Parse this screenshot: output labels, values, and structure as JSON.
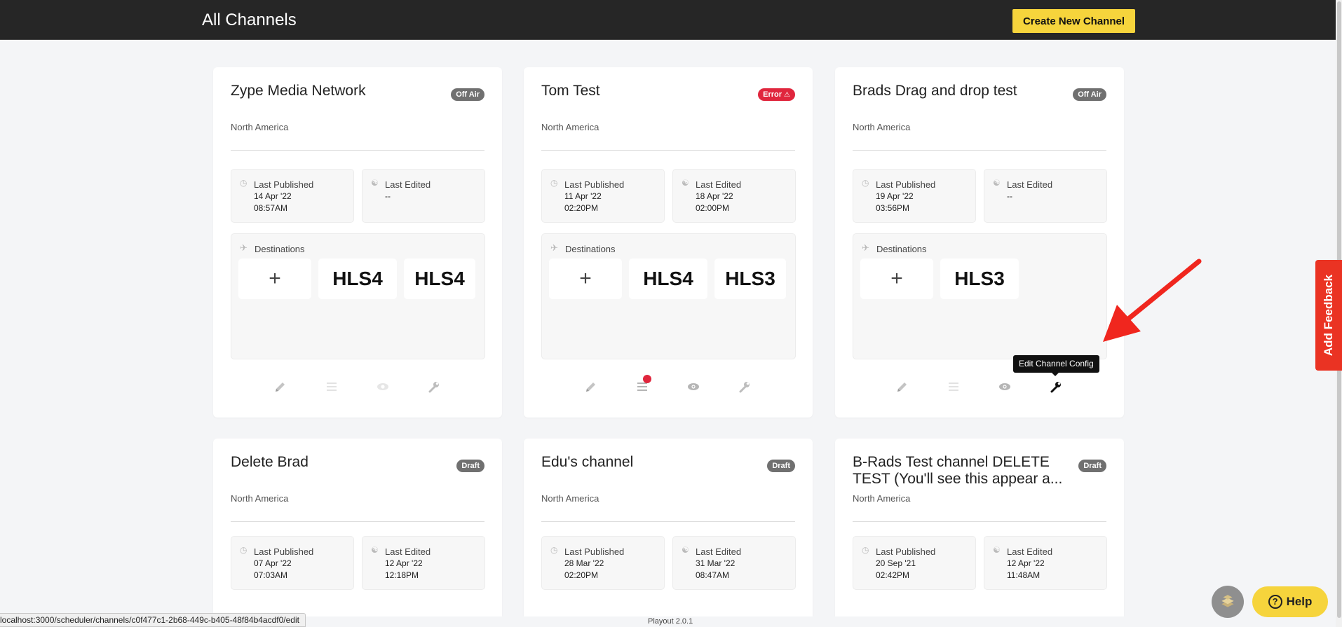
{
  "header": {
    "title": "All Channels",
    "create_button": "Create New Channel"
  },
  "channels": [
    {
      "name": "Zype Media Network",
      "status": "Off Air",
      "region": "North America",
      "last_published": {
        "label": "Last Published",
        "date": "14 Apr '22",
        "time": "08:57AM"
      },
      "last_edited": {
        "label": "Last Edited",
        "date": "--",
        "time": ""
      },
      "destinations_label": "Destinations",
      "destinations": [
        "+",
        "HLS4",
        "HLS4"
      ]
    },
    {
      "name": "Tom Test",
      "status": "Error",
      "region": "North America",
      "last_published": {
        "label": "Last Published",
        "date": "11 Apr '22",
        "time": "02:20PM"
      },
      "last_edited": {
        "label": "Last Edited",
        "date": "18 Apr '22",
        "time": "02:00PM"
      },
      "destinations_label": "Destinations",
      "destinations": [
        "+",
        "HLS4",
        "HLS3"
      ]
    },
    {
      "name": "Brads Drag and drop test",
      "status": "Off Air",
      "region": "North America",
      "last_published": {
        "label": "Last Published",
        "date": "19 Apr '22",
        "time": "03:56PM"
      },
      "last_edited": {
        "label": "Last Edited",
        "date": "--",
        "time": ""
      },
      "destinations_label": "Destinations",
      "destinations": [
        "+",
        "HLS3"
      ]
    },
    {
      "name": "Delete Brad",
      "status": "Draft",
      "region": "North America",
      "last_published": {
        "label": "Last Published",
        "date": "07 Apr '22",
        "time": "07:03AM"
      },
      "last_edited": {
        "label": "Last Edited",
        "date": "12 Apr '22",
        "time": "12:18PM"
      }
    },
    {
      "name": "Edu's channel",
      "status": "Draft",
      "region": "North America",
      "last_published": {
        "label": "Last Published",
        "date": "28 Mar '22",
        "time": "02:20PM"
      },
      "last_edited": {
        "label": "Last Edited",
        "date": "31 Mar '22",
        "time": "08:47AM"
      }
    },
    {
      "name": "B-Rads Test channel DELETE TEST (You'll see this appear a...",
      "status": "Draft",
      "region": "North America",
      "last_published": {
        "label": "Last Published",
        "date": "20 Sep '21",
        "time": "02:42PM"
      },
      "last_edited": {
        "label": "Last Edited",
        "date": "12 Apr '22",
        "time": "11:48AM"
      }
    }
  ],
  "tooltip": "Edit Channel Config",
  "feedback_tab": "Add Feedback",
  "help_button": "Help",
  "help_icon": "?",
  "version": "Playout 2.0.1",
  "status_url": "localhost:3000/scheduler/channels/c0f477c1-2b68-449c-b405-48f84b4acdf0/edit",
  "colors": {
    "header_bg": "#262626",
    "accent_yellow": "#f6d43c",
    "error_red": "#e0263d",
    "feedback_red": "#ea3323",
    "off_air_gray": "#707070"
  }
}
